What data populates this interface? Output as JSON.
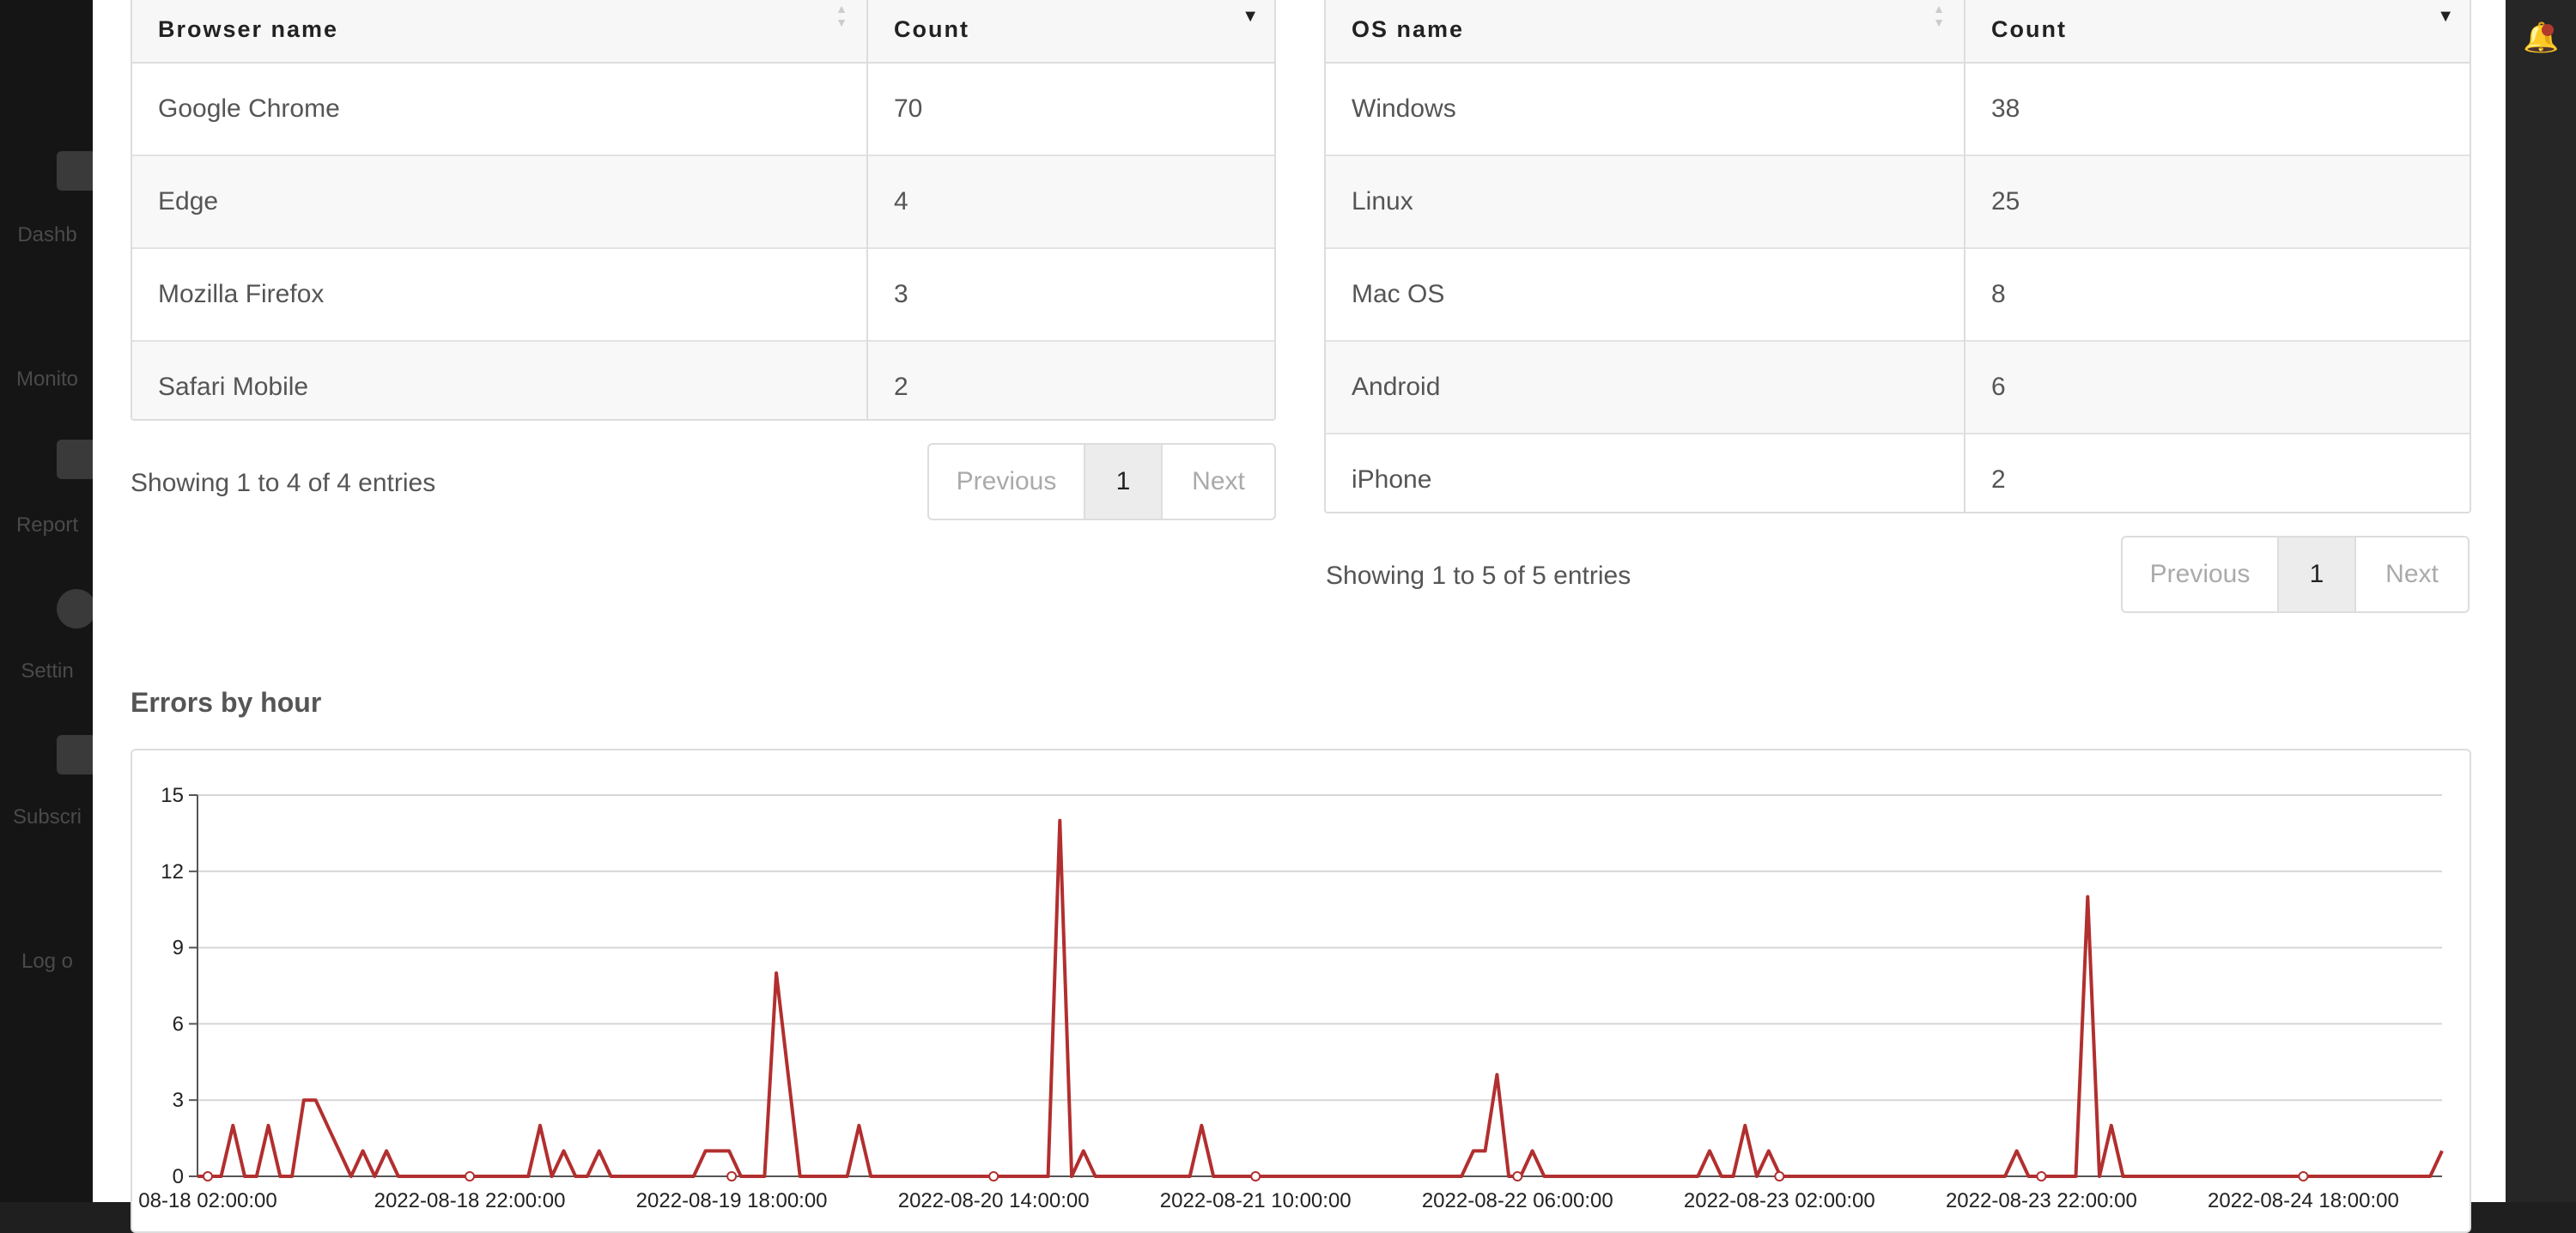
{
  "background": {
    "sidebar_items": [
      "Dashb",
      "Monito",
      "Report",
      "Settin",
      "Subscri",
      "Log o"
    ]
  },
  "browser_table": {
    "headers": [
      "Browser name",
      "Count"
    ],
    "rows": [
      [
        "Google Chrome",
        "70"
      ],
      [
        "Edge",
        "4"
      ],
      [
        "Mozilla Firefox",
        "3"
      ],
      [
        "Safari Mobile",
        "2"
      ]
    ],
    "info": "Showing 1 to 4 of 4 entries",
    "pagination": {
      "previous": "Previous",
      "current": "1",
      "next": "Next"
    }
  },
  "os_table": {
    "headers": [
      "OS name",
      "Count"
    ],
    "rows": [
      [
        "Windows",
        "38"
      ],
      [
        "Linux",
        "25"
      ],
      [
        "Mac OS",
        "8"
      ],
      [
        "Android",
        "6"
      ],
      [
        "iPhone",
        "2"
      ]
    ],
    "info": "Showing 1 to 5 of 5 entries",
    "pagination": {
      "previous": "Previous",
      "current": "1",
      "next": "Next"
    }
  },
  "errors_chart": {
    "title": "Errors by hour"
  },
  "chart_data": {
    "type": "line",
    "title": "Errors by hour",
    "color": "#b22f2f",
    "ylim": [
      0,
      15
    ],
    "yticks": [
      0,
      3,
      6,
      9,
      12,
      15
    ],
    "grid": true,
    "xticks": [
      "08-18 02:00:00",
      "2022-08-18 22:00:00",
      "2022-08-19 18:00:00",
      "2022-08-20 14:00:00",
      "2022-08-21 10:00:00",
      "2022-08-22 06:00:00",
      "2022-08-23 02:00:00",
      "2022-08-23 22:00:00",
      "2022-08-24 18:00:00"
    ],
    "series": [
      {
        "values": [
          0,
          0,
          0,
          2,
          0,
          0,
          2,
          0,
          0,
          3,
          3,
          2,
          1,
          0,
          1,
          0,
          1,
          0,
          0,
          0,
          0,
          0,
          0,
          0,
          0,
          0,
          0,
          0,
          0,
          2,
          0,
          1,
          0,
          0,
          1,
          0,
          0,
          0,
          0,
          0,
          0,
          0,
          0,
          1,
          1,
          1,
          0,
          0,
          0,
          8,
          4,
          0,
          0,
          0,
          0,
          0,
          2,
          0,
          0,
          0,
          0,
          0,
          0,
          0,
          0,
          0,
          0,
          0,
          0,
          0,
          0,
          0,
          0,
          14,
          0,
          1,
          0,
          0,
          0,
          0,
          0,
          0,
          0,
          0,
          0,
          2,
          0,
          0,
          0,
          0,
          0,
          0,
          0,
          0,
          0,
          0,
          0,
          0,
          0,
          0,
          0,
          0,
          0,
          0,
          0,
          0,
          0,
          0,
          1,
          1,
          4,
          0,
          0,
          1,
          0,
          0,
          0,
          0,
          0,
          0,
          0,
          0,
          0,
          0,
          0,
          0,
          0,
          0,
          1,
          0,
          0,
          2,
          0,
          1,
          0,
          0,
          0,
          0,
          0,
          0,
          0,
          0,
          0,
          0,
          0,
          0,
          0,
          0,
          0,
          0,
          0,
          0,
          0,
          0,
          1,
          0,
          0,
          0,
          0,
          0,
          11,
          0,
          2,
          0,
          0,
          0,
          0,
          0,
          0,
          0,
          0,
          0,
          0,
          0,
          0,
          0,
          0,
          0,
          0,
          0,
          0,
          0,
          0,
          0,
          0,
          0,
          0,
          0,
          0,
          0,
          1
        ]
      }
    ]
  }
}
